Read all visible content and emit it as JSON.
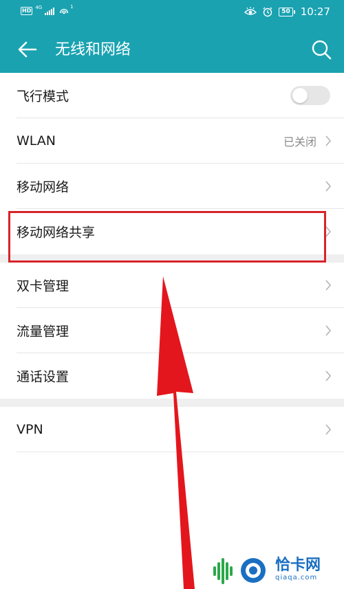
{
  "status_bar": {
    "hd": "HD",
    "network": "4G",
    "hotspot_count": "1",
    "battery": "50",
    "time": "10:27"
  },
  "app_bar": {
    "title": "无线和网络",
    "back_icon": "back-arrow-icon",
    "search_icon": "search-icon"
  },
  "settings": {
    "airplane_mode": {
      "label": "飞行模式",
      "enabled": false
    },
    "wlan": {
      "label": "WLAN",
      "value": "已关闭"
    },
    "mobile_network": {
      "label": "移动网络"
    },
    "tethering": {
      "label": "移动网络共享"
    },
    "dual_sim": {
      "label": "双卡管理"
    },
    "data_usage": {
      "label": "流量管理"
    },
    "call_settings": {
      "label": "通话设置"
    },
    "vpn": {
      "label": "VPN"
    }
  },
  "annotation": {
    "highlight_color": "#d8232a",
    "highlighted_item": "移动网络共享"
  },
  "watermark": {
    "name": "恰卡网",
    "url": "qiaqa.com"
  },
  "colors": {
    "app_bar": "#1aa2b1",
    "toggle_off": "#e6e6e6",
    "value_text": "#8a8a8a",
    "watermark": "#1a6fc2"
  }
}
